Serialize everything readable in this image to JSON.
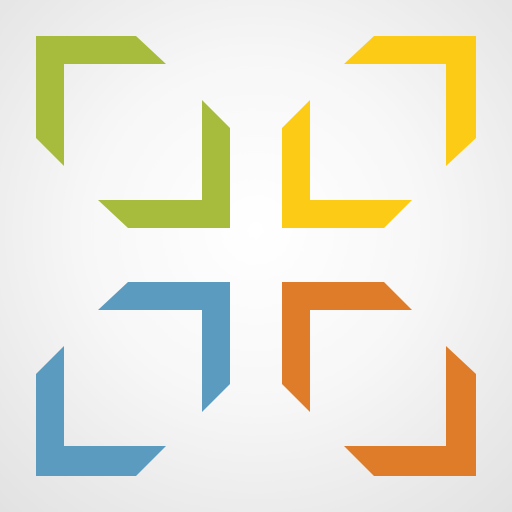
{
  "logo": {
    "icon_name": "four-corner-brackets-icon",
    "colors": {
      "green": "#A7BC3C",
      "yellow": "#FCCB16",
      "blue": "#5B9BC0",
      "orange": "#DE7C2A"
    }
  }
}
